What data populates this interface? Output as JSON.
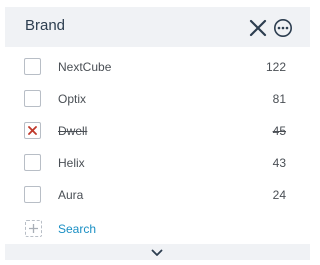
{
  "facet": {
    "title": "Brand",
    "close_icon": "close-icon",
    "more_icon": "more-options-icon",
    "items": [
      {
        "label": "NextCube",
        "count": "122",
        "state": "unchecked"
      },
      {
        "label": "Optix",
        "count": "81",
        "state": "unchecked"
      },
      {
        "label": "Dwell",
        "count": "45",
        "state": "excluded"
      },
      {
        "label": "Helix",
        "count": "43",
        "state": "unchecked"
      },
      {
        "label": "Aura",
        "count": "24",
        "state": "unchecked"
      }
    ],
    "search_label": "Search",
    "expand_icon": "chevron-down-icon"
  },
  "colors": {
    "header_bg": "#f0f2f5",
    "title": "#2d3e50",
    "accent": "#1a8fc4",
    "exclude_mark": "#c0392b"
  }
}
